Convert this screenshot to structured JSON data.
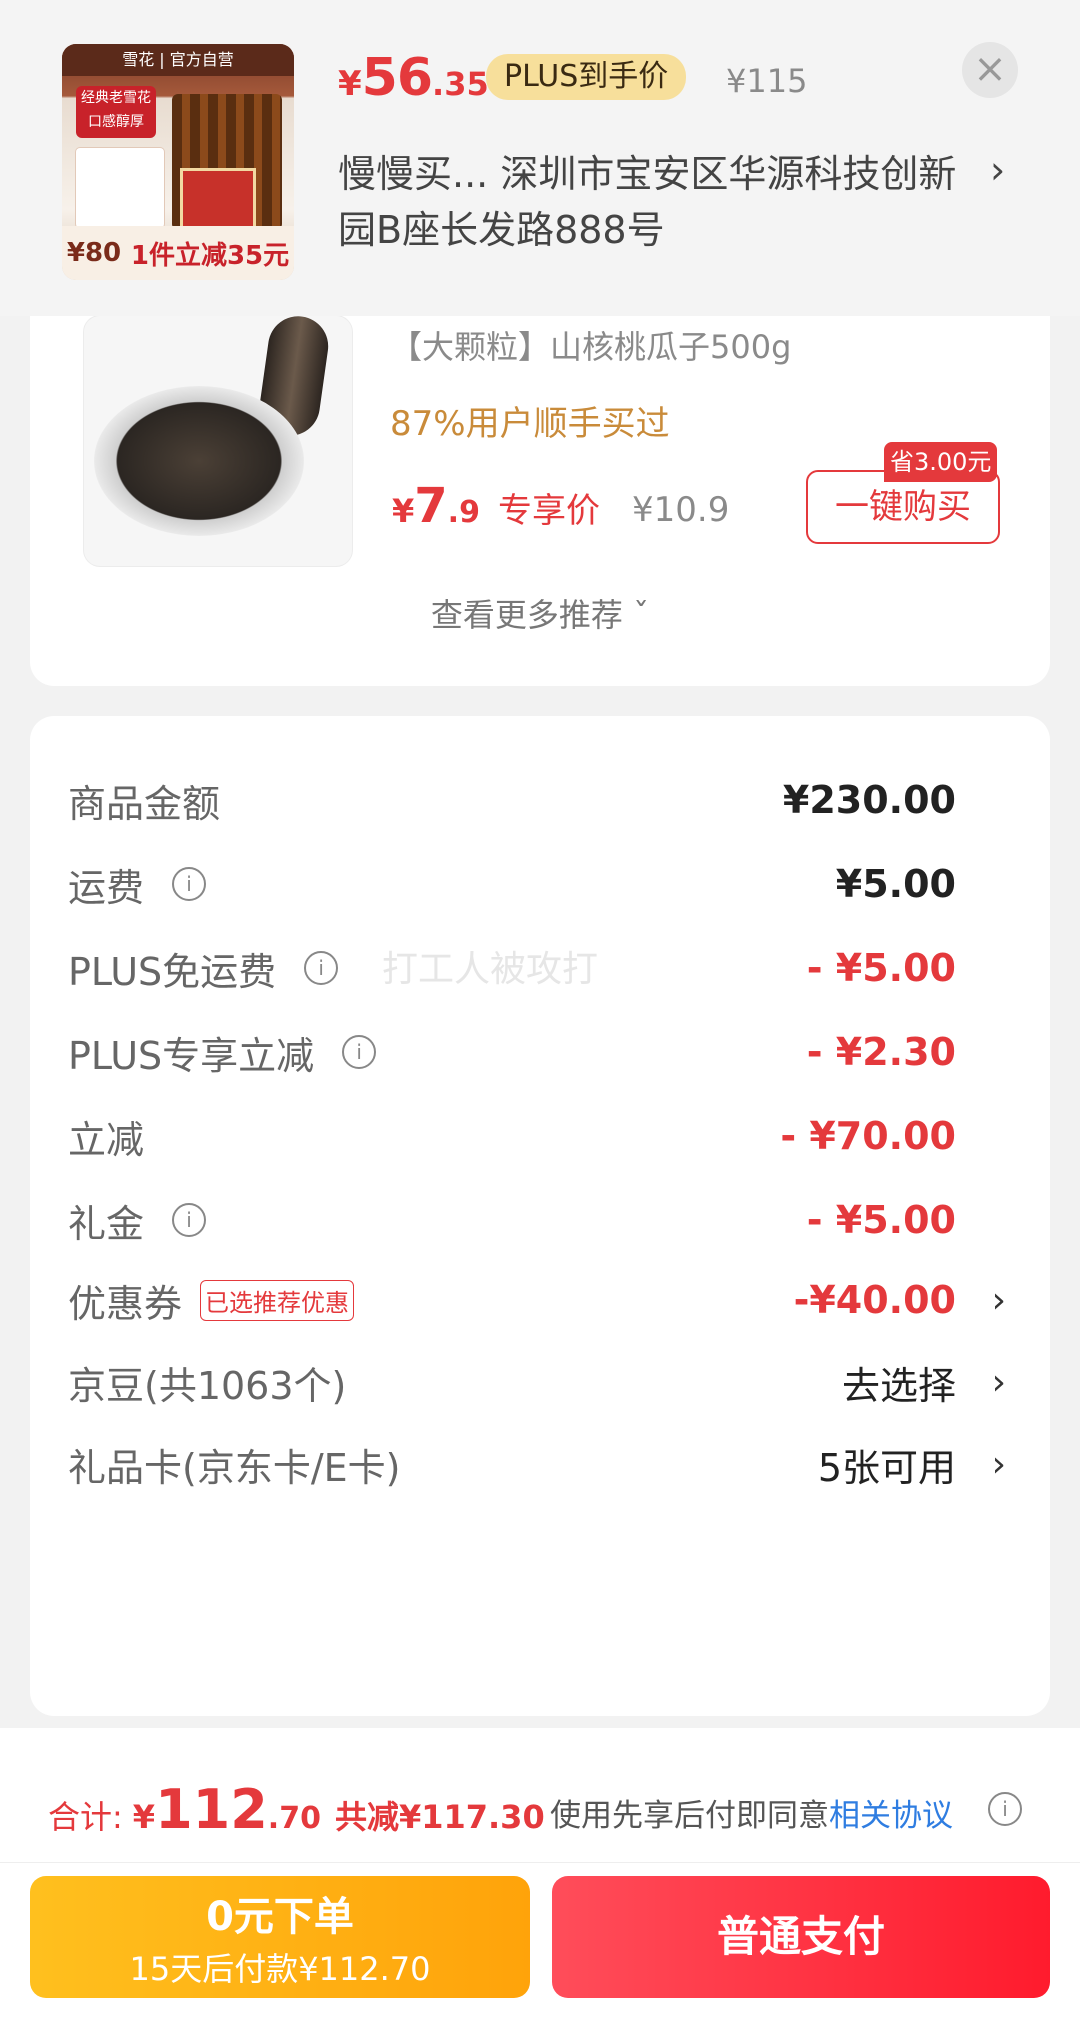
{
  "header": {
    "product_thumb": {
      "brand": "雪花 | 官方自营",
      "tag": "经典老雪花 口感醇厚",
      "bottom_left": "¥80",
      "bottom_right": "1件立减35元"
    },
    "price_symbol": "¥",
    "price_int": "56",
    "price_dec": ".35",
    "plus_tag": "PLUS到手价",
    "original_price": "¥115",
    "address": "慢慢买...  深圳市宝安区华源科技创新园B座长发路888号",
    "close_icon": "close-icon",
    "chevron_icon": "chevron-right-icon"
  },
  "recommendation": {
    "name": "【大颗粒】山核桃瓜子500g",
    "bought": "87%用户顺手买过",
    "price_symbol": "¥",
    "price_int": "7",
    "price_dec": ".9",
    "price_label": "专享价",
    "original_price": "¥10.9",
    "save_badge": "省3.00元",
    "buy_button": "一键购买",
    "more": "查看更多推荐 ˇ"
  },
  "breakdown": [
    {
      "label": "商品金额",
      "value": "¥230.00",
      "info": false,
      "style": "normal"
    },
    {
      "label": "运费",
      "value": "¥5.00",
      "info": true,
      "style": "normal"
    },
    {
      "label": "PLUS免运费",
      "value": "- ¥5.00",
      "info": true,
      "style": "red"
    },
    {
      "label": "PLUS专享立减",
      "value": "- ¥2.30",
      "info": true,
      "style": "red"
    },
    {
      "label": "立减",
      "value": "- ¥70.00",
      "info": false,
      "style": "red"
    },
    {
      "label": "礼金",
      "value": "- ¥5.00",
      "info": true,
      "style": "red"
    },
    {
      "label": "优惠券",
      "tag": "已选推荐优惠",
      "value": "-¥40.00",
      "chevron": true,
      "style": "red"
    },
    {
      "label": "京豆(共1063个)",
      "value": "去选择",
      "chevron": true,
      "style": "plain"
    },
    {
      "label": "礼品卡(京东卡/E卡)",
      "value": "5张可用",
      "chevron": true,
      "style": "plain"
    }
  ],
  "watermark": "打工人被攻打",
  "footer": {
    "total_label": "合计:",
    "total_symbol": "¥",
    "total_int": "112",
    "total_dec": ".70",
    "saved": "共减¥117.30",
    "agree_text": "使用先享后付即同意",
    "agree_link": "相关协议",
    "btn_zero_line1": "0元下单",
    "btn_zero_line2": "15天后付款¥112.70",
    "btn_pay": "普通支付"
  },
  "colors": {
    "accent_red": "#e4393c",
    "plus_gold": "#f7df9b",
    "link_blue": "#2f7de1"
  }
}
